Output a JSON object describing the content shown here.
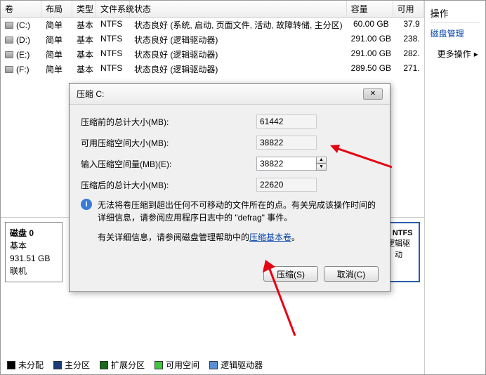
{
  "table": {
    "headers": {
      "volume": "卷",
      "layout": "布局",
      "type": "类型",
      "filesystem": "文件系统",
      "status": "状态",
      "capacity": "容量",
      "available": "可用"
    },
    "rows": [
      {
        "vol": "(C:)",
        "layout": "简单",
        "type": "基本",
        "fs": "NTFS",
        "status": "状态良好 (系统, 启动, 页面文件, 活动, 故障转储, 主分区)",
        "cap": "60.00 GB",
        "avail": "37.9"
      },
      {
        "vol": "(D:)",
        "layout": "简单",
        "type": "基本",
        "fs": "NTFS",
        "status": "状态良好 (逻辑驱动器)",
        "cap": "291.00 GB",
        "avail": "238."
      },
      {
        "vol": "(E:)",
        "layout": "简单",
        "type": "基本",
        "fs": "NTFS",
        "status": "状态良好 (逻辑驱动器)",
        "cap": "291.00 GB",
        "avail": "282."
      },
      {
        "vol": "(F:)",
        "layout": "简单",
        "type": "基本",
        "fs": "NTFS",
        "status": "状态良好 (逻辑驱动器)",
        "cap": "289.50 GB",
        "avail": "271."
      }
    ]
  },
  "diskInfo": {
    "title": "磁盘 0",
    "type": "基本",
    "size": "931.51 GB",
    "status": "联机"
  },
  "diskPart": {
    "fs": "NTFS",
    "desc": "逻辑驱动"
  },
  "legend": {
    "unalloc": "未分配",
    "primary": "主分区",
    "extended": "扩展分区",
    "free": "可用空间",
    "logical": "逻辑驱动器"
  },
  "sidebar": {
    "title": "操作",
    "link": "磁盘管理",
    "more": "更多操作"
  },
  "dialog": {
    "title": "压缩 C:",
    "rows": {
      "before": {
        "label": "压缩前的总计大小(MB):",
        "value": "61442"
      },
      "avail": {
        "label": "可用压缩空间大小(MB):",
        "value": "38822"
      },
      "input": {
        "label": "输入压缩空间量(MB)(E):",
        "value": "38822"
      },
      "after": {
        "label": "压缩后的总计大小(MB):",
        "value": "22620"
      }
    },
    "info1a": "无法将卷压缩到超出任何不可移动的文件所在的点。有关完成该操作时间的",
    "info1b": "详细信息，请参阅应用程序日志中的 \"defrag\" 事件。",
    "info2a": "有关详细信息，请参阅磁盘管理帮助中的",
    "info2link": "压缩基本卷",
    "info2b": "。",
    "buttons": {
      "shrink": "压缩(S)",
      "cancel": "取消(C)"
    }
  }
}
